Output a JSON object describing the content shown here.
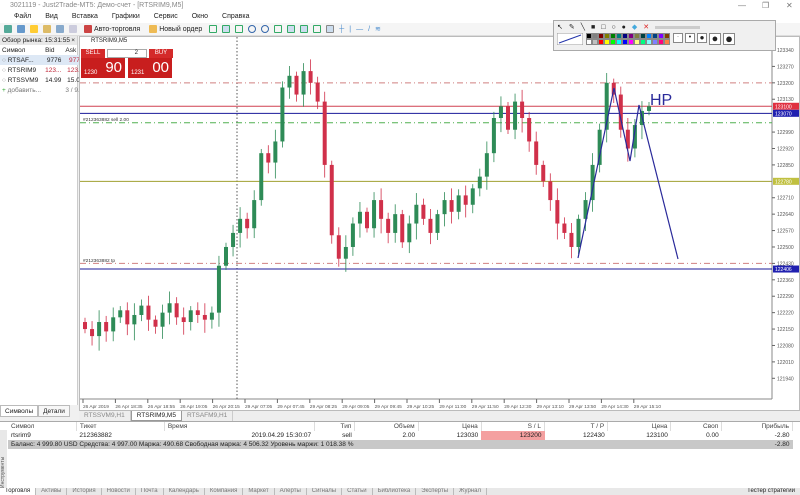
{
  "window": {
    "title": "3021119 - Just2Trade-MT5: Демо-счет - [RTSRIM9,M5]",
    "controls": [
      "—",
      "❐",
      "✕"
    ]
  },
  "menu": [
    "Файл",
    "Вид",
    "Вставка",
    "Графики",
    "Сервис",
    "Окно",
    "Справка"
  ],
  "toolbar": {
    "auto_trading": "Авто-торговля",
    "new_order": "Новый ордер"
  },
  "market_watch": {
    "title": "Обзор рынка: 15:31:55",
    "columns": [
      "Символ",
      "Bid",
      "Ask"
    ],
    "rows": [
      {
        "symbol": "RTSAF...",
        "bid": "9776",
        "ask": "9777",
        "ask_red": true
      },
      {
        "symbol": "RTSRIM9",
        "bid": "123...",
        "ask": "123...",
        "bid_red": true,
        "ask_red": true
      },
      {
        "symbol": "RTSSVM9",
        "bid": "14.99",
        "ask": "15.00"
      }
    ],
    "add": "добавить...",
    "count": "3 / 9...",
    "tabs": [
      "Символы",
      "Детали"
    ]
  },
  "one_click": {
    "symbol": "RTSRIM9,M5",
    "sell": "SELL",
    "buy": "BUY",
    "volume": "2",
    "sell_small": "1230",
    "sell_big": "90",
    "buy_small": "1231",
    "buy_big": "00"
  },
  "chart_data": {
    "type": "candlestick",
    "symbol": "RTSRIM9",
    "timeframe": "M5",
    "price_ticks": [
      123340,
      123270,
      123200,
      123130,
      122990,
      122920,
      122850,
      122710,
      122640,
      122570,
      122500,
      122430,
      122360,
      122290,
      122220,
      122150,
      122080,
      122010,
      121940
    ],
    "time_ticks": [
      "26 Apr 2019",
      "26 Apr 18:35",
      "26 Apr 18:55",
      "26 Apr 19:05",
      "26 Apr 20:15",
      "29 Apr 07:05",
      "29 Apr 07:45",
      "29 Apr 08:25",
      "29 Apr 09:05",
      "29 Apr 09:45",
      "29 Apr 10:25",
      "29 Apr 11:00",
      "29 Apr 11:50",
      "29 Apr 12:30",
      "29 Apr 13:10",
      "29 Apr 13:50",
      "29 Apr 14:30",
      "29 Apr 15:10"
    ],
    "closes": [
      122150,
      122120,
      122180,
      122140,
      122200,
      122230,
      122170,
      122210,
      122250,
      122190,
      122160,
      122220,
      122260,
      122200,
      122180,
      122230,
      122210,
      122190,
      122220,
      122420,
      122500,
      122560,
      122620,
      122580,
      122700,
      122900,
      122860,
      122950,
      123180,
      123230,
      123150,
      123250,
      123200,
      123120,
      122850,
      122550,
      122450,
      122500,
      122600,
      122650,
      122580,
      122700,
      122620,
      122560,
      122640,
      122520,
      122600,
      122680,
      122620,
      122560,
      122640,
      122700,
      122650,
      122720,
      122680,
      122750,
      122800,
      122900,
      123050,
      123100,
      123000,
      123120,
      123050,
      122950,
      122850,
      122780,
      122700,
      122600,
      122560,
      122500,
      122620,
      122700,
      122850,
      123000,
      123200,
      123150,
      123000,
      122920,
      123020,
      123080,
      123100
    ],
    "levels": [
      {
        "price": 123200,
        "style": "dashdot",
        "color": "#d08080",
        "label": ""
      },
      {
        "price": 123100,
        "style": "solid",
        "color": "#d04050",
        "badge": "123100",
        "badge_color": "#e03040"
      },
      {
        "price": 123070,
        "style": "solid",
        "color": "#1a1a9a",
        "badge": "123070",
        "badge_color": "#2020b0"
      },
      {
        "price": 123030,
        "style": "dashdot",
        "color": "#50b050",
        "label": "#212363882 sell 2.00"
      },
      {
        "price": 122780,
        "style": "solid",
        "color": "#a0a030",
        "badge": "122780",
        "badge_color": "#c0c040"
      },
      {
        "price": 122430,
        "style": "dashdot",
        "color": "#d08080",
        "label": "#212363882 tp"
      },
      {
        "price": 122406,
        "style": "solid",
        "color": "#1a1a9a",
        "badge": "122406",
        "badge_color": "#2020b0"
      }
    ],
    "annotation_text": "HP",
    "bull_color": "#2e8b57",
    "bear_color": "#d0304a"
  },
  "chart_tabs": [
    "RTSSVM9,H1",
    "RTSRIM9,M5",
    "RTSAFM9,H1"
  ],
  "terminal": {
    "columns": [
      "Символ",
      "Тикет",
      "Время",
      "Тип",
      "Объем",
      "Цена",
      "S / L",
      "T / P",
      "Цена",
      "Своп",
      "Прибыль"
    ],
    "position": {
      "symbol": "rtsrim9",
      "ticket": "212363882",
      "time": "2019.04.29 15:30:07",
      "type": "sell",
      "volume": "2.00",
      "open": "123030",
      "sl": "123200",
      "tp": "122430",
      "price": "123100",
      "swap": "0.00",
      "profit": "-2.80"
    },
    "balance": "Баланс: 4 999.80 USD  Средства: 4 997.00  Маржа: 490.68  Свободная маржа: 4 506.32  Уровень маржи: 1 018.38 %",
    "balance_profit": "-2.80",
    "side_label": "Инструменты",
    "tabs": [
      "Торговля",
      "Активы",
      "История",
      "Новости",
      "Почта",
      "Календарь",
      "Компания",
      "Маркет",
      "Алерты",
      "Сигналы",
      "Статьи",
      "Библиотека",
      "Эксперты",
      "Журнал"
    ],
    "tester": "Тестер стратегий"
  },
  "palette": [
    "#000000",
    "#808080",
    "#800000",
    "#808000",
    "#008000",
    "#008080",
    "#000080",
    "#800080",
    "#808040",
    "#004040",
    "#0080ff",
    "#004080",
    "#8000ff",
    "#804000",
    "#ffffff",
    "#c0c0c0",
    "#ff0000",
    "#ffff00",
    "#00ff00",
    "#00ffff",
    "#0000ff",
    "#ff00ff",
    "#ffff80",
    "#00ff80",
    "#80ffff",
    "#8080ff",
    "#ff0080",
    "#ff8040"
  ]
}
